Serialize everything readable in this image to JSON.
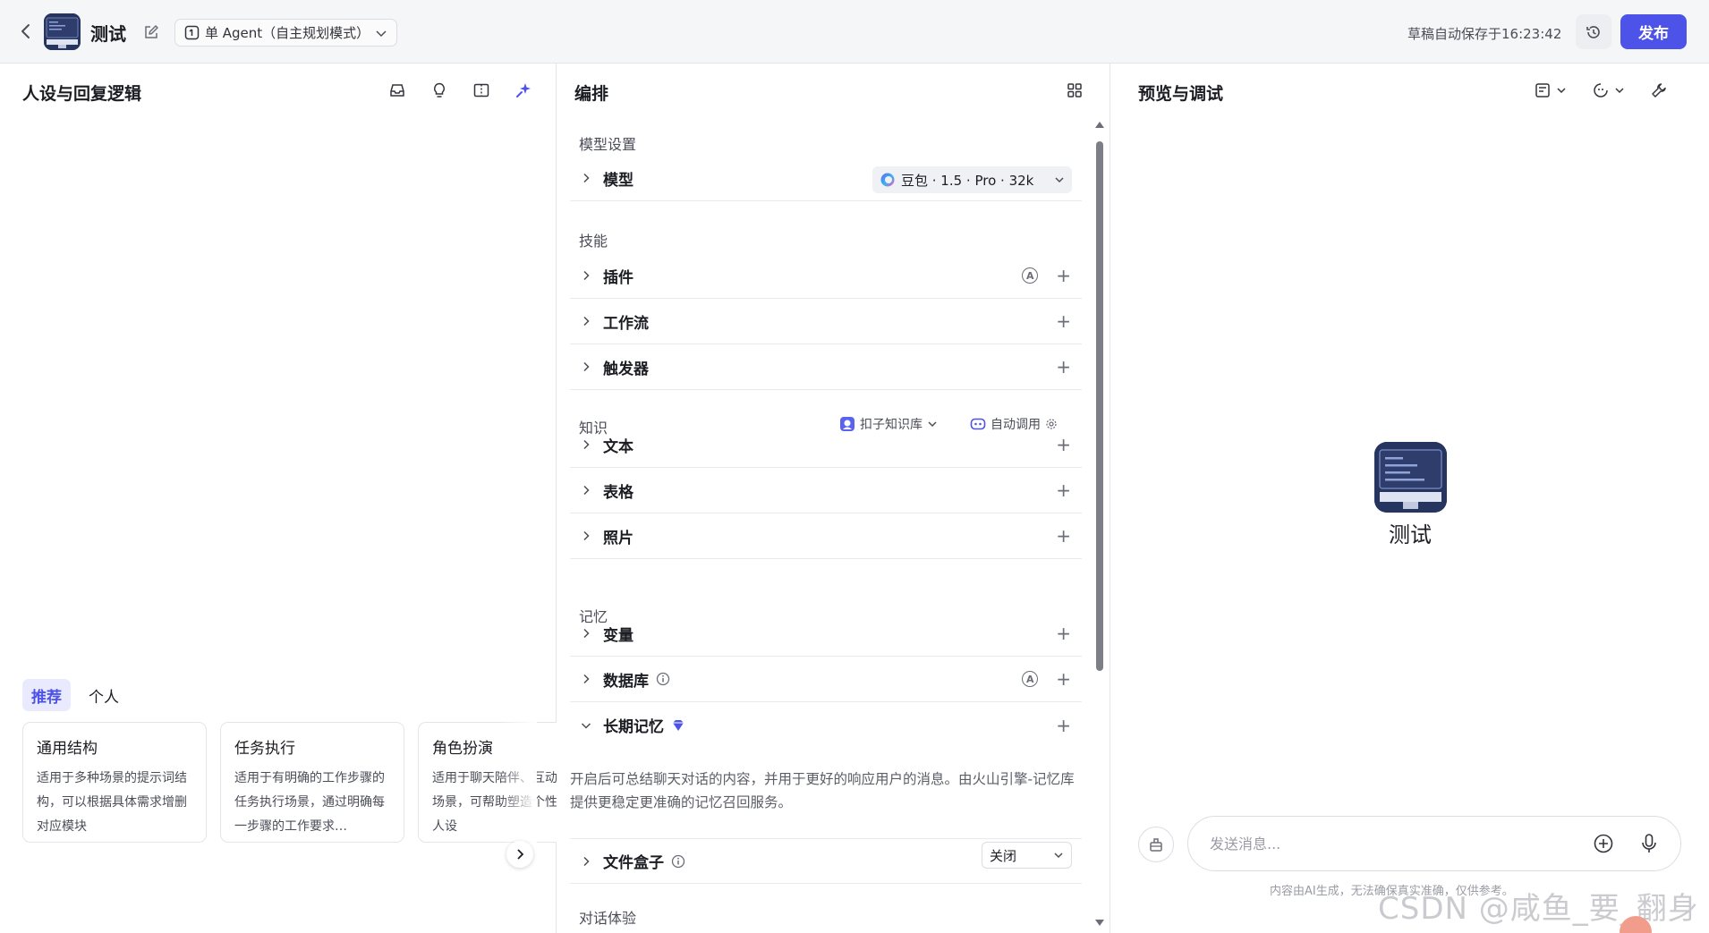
{
  "header": {
    "bot_name": "测试",
    "mode_label": "单 Agent（自主规划模式）",
    "autosave": "草稿自动保存于16:23:42",
    "publish_label": "发布"
  },
  "left_panel": {
    "title": "人设与回复逻辑",
    "tabs": [
      {
        "label": "推荐",
        "active": true
      },
      {
        "label": "个人",
        "active": false
      }
    ],
    "templates": [
      {
        "title": "通用结构",
        "desc": "适用于多种场景的提示词结构，可以根据具体需求增删对应模块"
      },
      {
        "title": "任务执行",
        "desc": "适用于有明确的工作步骤的任务执行场景，通过明确每一步骤的工作要求…"
      },
      {
        "title": "角色扮演",
        "desc": "适用于聊天陪伴、互动娱乐场景，可帮助塑造个性化的人设"
      }
    ]
  },
  "middle_panel": {
    "title": "编排",
    "model_section": "模型设置",
    "model_row": "模型",
    "model_value": "豆包 · 1.5 · Pro · 32k",
    "skills_section": "技能",
    "plugins": "插件",
    "workflow": "工作流",
    "trigger": "触发器",
    "knowledge_section": "知识",
    "knowledge_source": "扣子知识库",
    "knowledge_call": "自动调用",
    "text": "文本",
    "table": "表格",
    "photo": "照片",
    "memory_section": "记忆",
    "variables": "变量",
    "database": "数据库",
    "long_memory": "长期记忆",
    "long_memory_desc": "开启后可总结聊天对话的内容，并用于更好的响应用户的消息。由火山引擎-记忆库提供更稳定更准确的记忆召回服务。",
    "file_box": "文件盒子",
    "file_box_value": "关闭",
    "chat_section": "对话体验"
  },
  "right_panel": {
    "title": "预览与调试",
    "bot_name": "测试",
    "input_placeholder": "发送消息...",
    "disclaimer": "内容由AI生成，无法确保真实准确，仅供参考。",
    "watermark": "CSDN @咸鱼_要_翻身"
  },
  "colors": {
    "accent": "#4d53e8",
    "premium": "#4d53e8"
  }
}
